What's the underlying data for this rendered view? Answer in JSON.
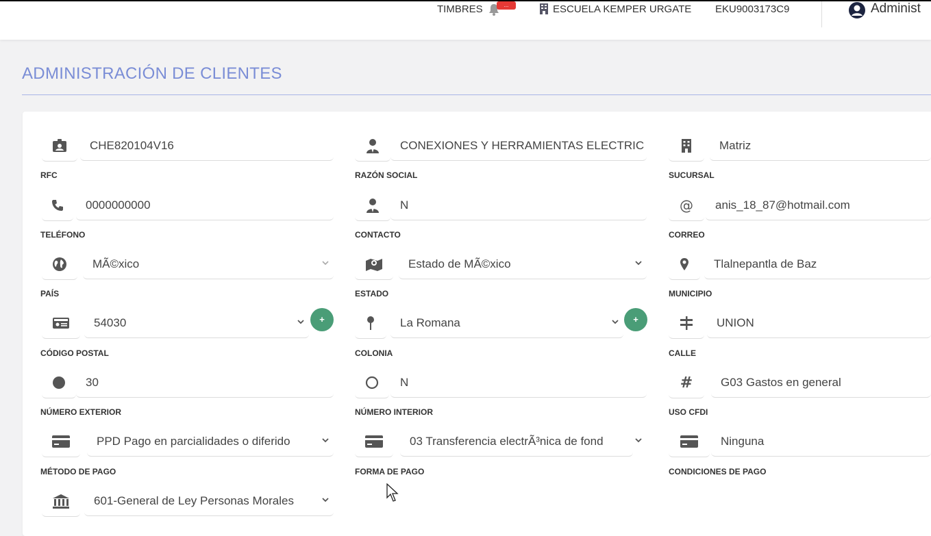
{
  "header": {
    "timbres_label": "TIMBRES",
    "badge": "...",
    "escuela": "ESCUELA KEMPER URGATE",
    "rfc_empresa": "EKU9003173C9",
    "user": "Administ"
  },
  "page": {
    "title": "ADMINISTRACIÓN DE CLIENTES"
  },
  "fields": {
    "rfc": {
      "label": "RFC",
      "value": "CHE820104V16",
      "icon": "id-card-icon"
    },
    "razon_social": {
      "label": "RAZÓN SOCIAL",
      "value": "CONEXIONES Y HERRAMIENTAS ELECTRIC",
      "icon": "user-tie-icon"
    },
    "sucursal": {
      "label": "SUCURSAL",
      "value": "Matriz",
      "icon": "building-icon"
    },
    "telefono": {
      "label": "TELÉFONO",
      "value": "0000000000",
      "icon": "phone-icon"
    },
    "contacto": {
      "label": "CONTACTO",
      "value": "N",
      "icon": "user-tie-icon"
    },
    "correo": {
      "label": "CORREO",
      "value": "anis_18_87@hotmail.com",
      "icon": "at-icon"
    },
    "pais": {
      "label": "PAÍS",
      "value": "MÃ©xico",
      "icon": "globe-icon"
    },
    "estado": {
      "label": "ESTADO",
      "value": "Estado de MÃ©xico",
      "icon": "map-icon"
    },
    "municipio": {
      "label": "MUNICIPIO",
      "value": "Tlalnepantla de Baz",
      "icon": "map-marker-icon"
    },
    "codigo_postal": {
      "label": "CÓDIGO POSTAL",
      "value": "54030",
      "icon": "address-card-icon"
    },
    "colonia": {
      "label": "COLONIA",
      "value": "La Romana",
      "icon": "map-pin-icon"
    },
    "calle": {
      "label": "CALLE",
      "value": "UNION",
      "icon": "signs-icon"
    },
    "numero_exterior": {
      "label": "NÚMERO EXTERIOR",
      "value": "30",
      "icon": "circle-filled-icon"
    },
    "numero_interior": {
      "label": "NÚMERO INTERIOR",
      "value": "N",
      "icon": "circle-outline-icon"
    },
    "uso_cfdi": {
      "label": "USO CFDI",
      "value": "G03 Gastos en general",
      "icon": "hashtag-icon"
    },
    "metodo_pago": {
      "label": "MÉTODO DE PAGO",
      "value": "PPD Pago en parcialidades o diferido",
      "icon": "credit-card-icon"
    },
    "forma_pago": {
      "label": "FORMA DE PAGO",
      "value": "03 Transferencia electrÃ³nica de fond",
      "icon": "credit-card-icon"
    },
    "condiciones_pago": {
      "label": "CONDICIONES DE PAGO",
      "value": "Ninguna",
      "icon": "credit-card-icon"
    },
    "regimen": {
      "value": "601-General de Ley Personas Morales",
      "icon": "bank-icon"
    }
  },
  "buttons": {
    "add_label": "+"
  },
  "colors": {
    "title": "#7a8dd6",
    "add_button": "#4a9d77",
    "badge": "#e53935"
  }
}
